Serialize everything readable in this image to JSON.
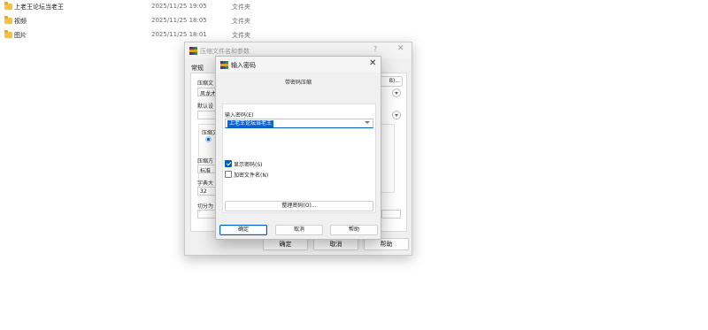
{
  "explorer": {
    "rows": [
      {
        "name": "上老王论坛当老王",
        "date": "2025/11/25 19:05",
        "type": "文件夹"
      },
      {
        "name": "视频",
        "date": "2025/11/25 18:05",
        "type": "文件夹"
      },
      {
        "name": "图片",
        "date": "2025/11/25 18:01",
        "type": "文件夹"
      }
    ]
  },
  "compress_dialog": {
    "title": "压缩文件名和参数",
    "help": "?",
    "close": "✕",
    "tab_general": "常规",
    "label_archive_name": "压缩文",
    "archive_name_value": "风龙才",
    "browse_label": "B)...",
    "label_default": "默认设",
    "label_format": "压缩文",
    "label_method": "压缩方",
    "method_value": "标准",
    "label_dict": "字典大",
    "dict_value": "32",
    "label_split": "切分为",
    "ok": "确定",
    "cancel": "取消",
    "help_btn": "帮助"
  },
  "password_dialog": {
    "title": "输入密码",
    "close": "✕",
    "subtitle": "带密码压缩",
    "password_label": "输入密码(E)",
    "password_value": "上老王论坛当老王",
    "show_password_label": "显示密码(S)",
    "show_password_checked": true,
    "encrypt_names_label": "加密文件名(N)",
    "encrypt_names_checked": false,
    "manage_button": "整理密码(O)...",
    "ok": "确定",
    "cancel": "取消",
    "help": "帮助"
  },
  "colors": {
    "accent": "#005fb8",
    "selection": "#0a64d6",
    "folder": "#f2c14e"
  }
}
